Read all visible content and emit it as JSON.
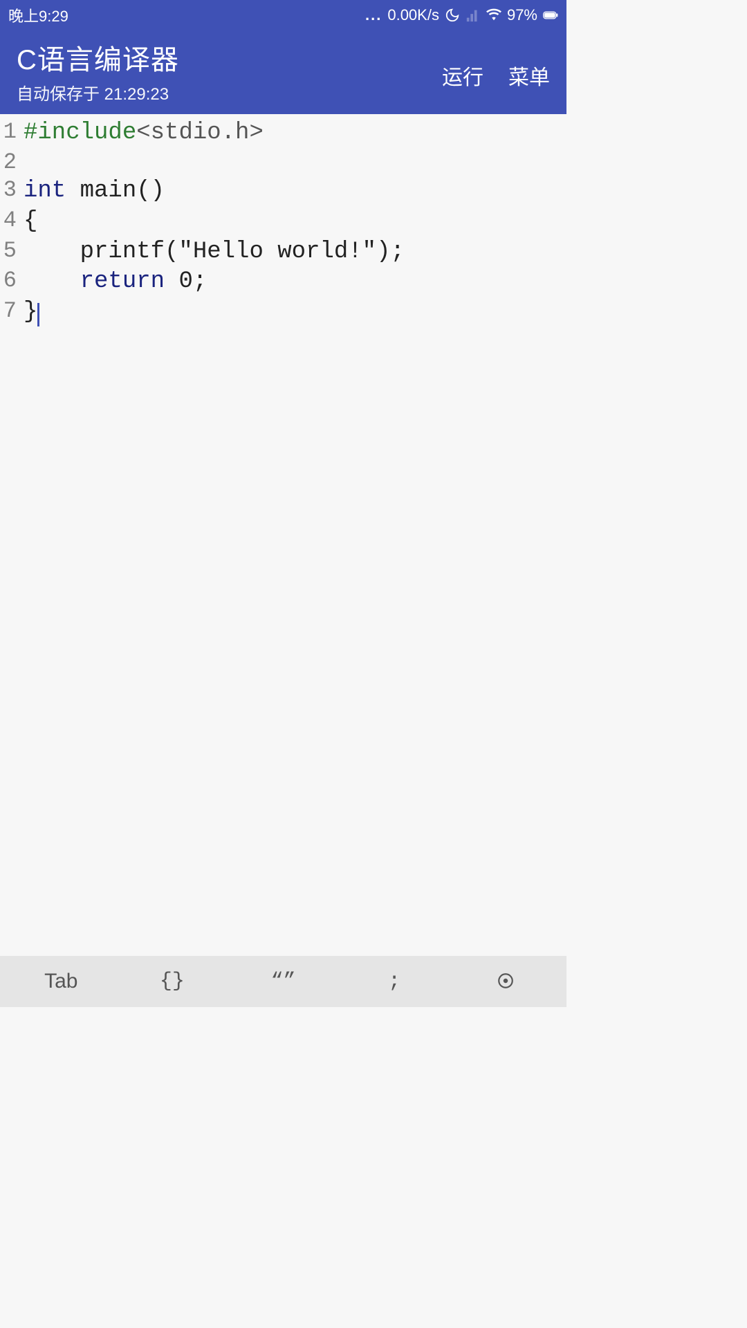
{
  "status_bar": {
    "time": "晚上9:29",
    "more": "...",
    "speed": "0.00K/s",
    "battery_pct": "97%"
  },
  "header": {
    "title": "C语言编译器",
    "subtitle": "自动保存于 21:29:23",
    "run_label": "运行",
    "menu_label": "菜单"
  },
  "code_lines": [
    {
      "n": "1",
      "pre": "#include",
      "rest": "<stdio.h>"
    },
    {
      "n": "2",
      "rest": ""
    },
    {
      "n": "3",
      "kw": "int",
      "rest": " main()"
    },
    {
      "n": "4",
      "rest": "{"
    },
    {
      "n": "5",
      "rest": "    printf(\"Hello world!\");"
    },
    {
      "n": "6",
      "indent": "    ",
      "ret": "return",
      "rest2": " 0;"
    },
    {
      "n": "7",
      "rest": "}",
      "cursor": true
    }
  ],
  "bottom_bar": {
    "tab": "Tab",
    "braces": "{}",
    "quotes": "“”",
    "semicolon": ";"
  }
}
